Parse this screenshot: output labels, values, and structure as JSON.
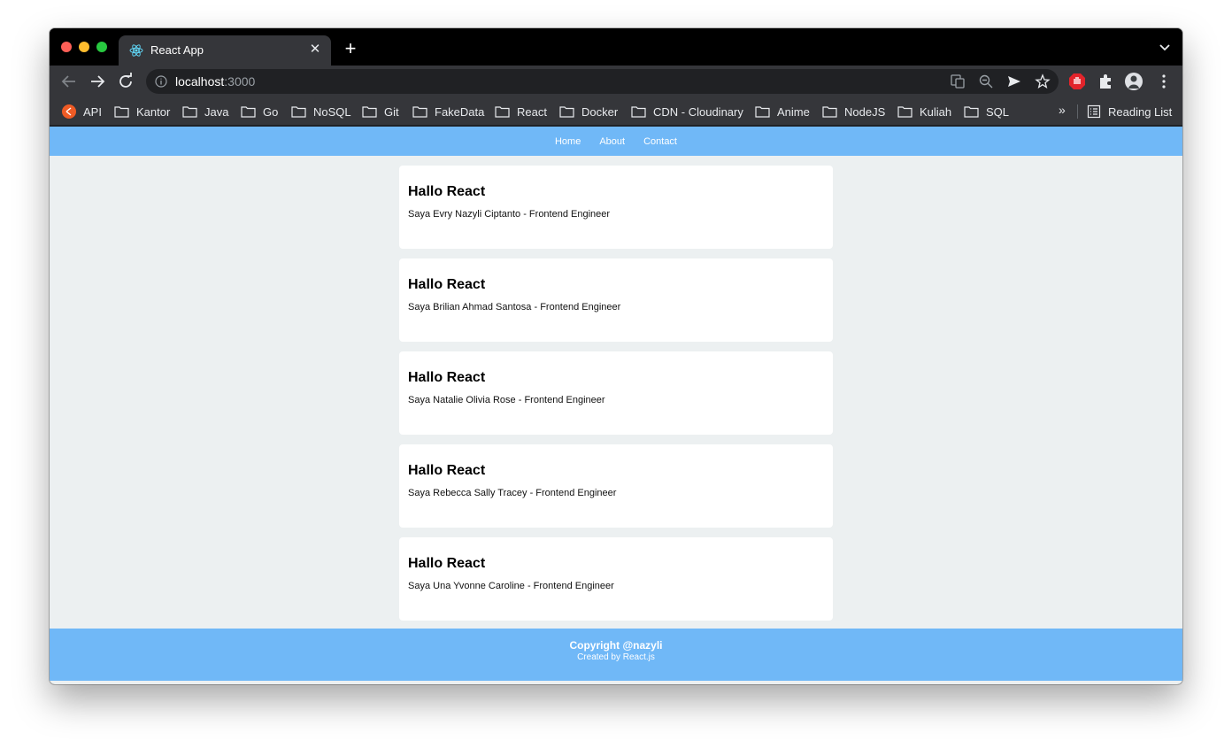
{
  "browser": {
    "tab_title": "React App",
    "url_host": "localhost",
    "url_port": ":3000",
    "bookmarks": [
      "API",
      "Kantor",
      "Java",
      "Go",
      "NoSQL",
      "Git",
      "FakeData",
      "React",
      "Docker",
      "CDN - Cloudinary",
      "Anime",
      "NodeJS",
      "Kuliah",
      "SQL"
    ],
    "reading_list": "Reading List",
    "more_bookmarks": "»"
  },
  "nav": {
    "home": "Home",
    "about": "About",
    "contact": "Contact"
  },
  "cards": [
    {
      "title": "Hallo React",
      "text": "Saya Evry Nazyli Ciptanto - Frontend Engineer"
    },
    {
      "title": "Hallo React",
      "text": "Saya Brilian Ahmad Santosa - Frontend Engineer"
    },
    {
      "title": "Hallo React",
      "text": "Saya Natalie Olivia Rose - Frontend Engineer"
    },
    {
      "title": "Hallo React",
      "text": "Saya Rebecca Sally Tracey - Frontend Engineer"
    },
    {
      "title": "Hallo React",
      "text": "Saya Una Yvonne Caroline - Frontend Engineer"
    }
  ],
  "footer": {
    "copyright": "Copyright @nazyli",
    "credit": "Created by React.js"
  },
  "colors": {
    "accent": "#70b8f7",
    "page_bg": "#ecf0f1"
  }
}
